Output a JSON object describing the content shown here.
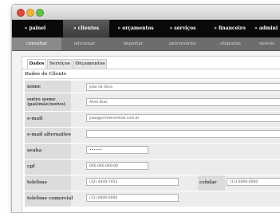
{
  "nav": {
    "items": [
      {
        "label": "» painel"
      },
      {
        "label": "» clientes"
      },
      {
        "label": "» orçamentos"
      },
      {
        "label": "» serviços"
      },
      {
        "label": "» financeiro"
      },
      {
        "label": "» admini"
      }
    ],
    "active_index": 1
  },
  "subnav": {
    "items": [
      {
        "label": "consultar"
      },
      {
        "label": "adicionar"
      },
      {
        "label": "importar"
      },
      {
        "label": "aniversários"
      },
      {
        "label": "etiquetas"
      },
      {
        "label": "newsle"
      }
    ],
    "active_index": 0
  },
  "tabs": {
    "items": [
      {
        "label": "Dados"
      },
      {
        "label": "Serviços"
      },
      {
        "label": "Orçamentos"
      }
    ],
    "active_index": 0
  },
  "form": {
    "section_title": "Dados do Cliente",
    "fields": {
      "nome": {
        "label": "nome",
        "value": "João da Silva"
      },
      "outro_nome": {
        "label": "outro nome (pai/mãe/noivo)",
        "value": "Aline Dias"
      },
      "email": {
        "label": "e-mail",
        "value": "joao@primeiroemail.com.br"
      },
      "email_alt": {
        "label": "e-mail alternativo",
        "value": ""
      },
      "senha": {
        "label": "senha",
        "value": "••••••"
      },
      "cpf": {
        "label": "cpf",
        "value": "000.000.000-00"
      },
      "telefone": {
        "label": "telefone",
        "value": "(32) 4444-7452"
      },
      "celular": {
        "label": "celular",
        "value": "(11) 0000-0000"
      },
      "telefone_comercial": {
        "label": "telefone comercial",
        "value": "(11) 0000-0000"
      }
    }
  }
}
